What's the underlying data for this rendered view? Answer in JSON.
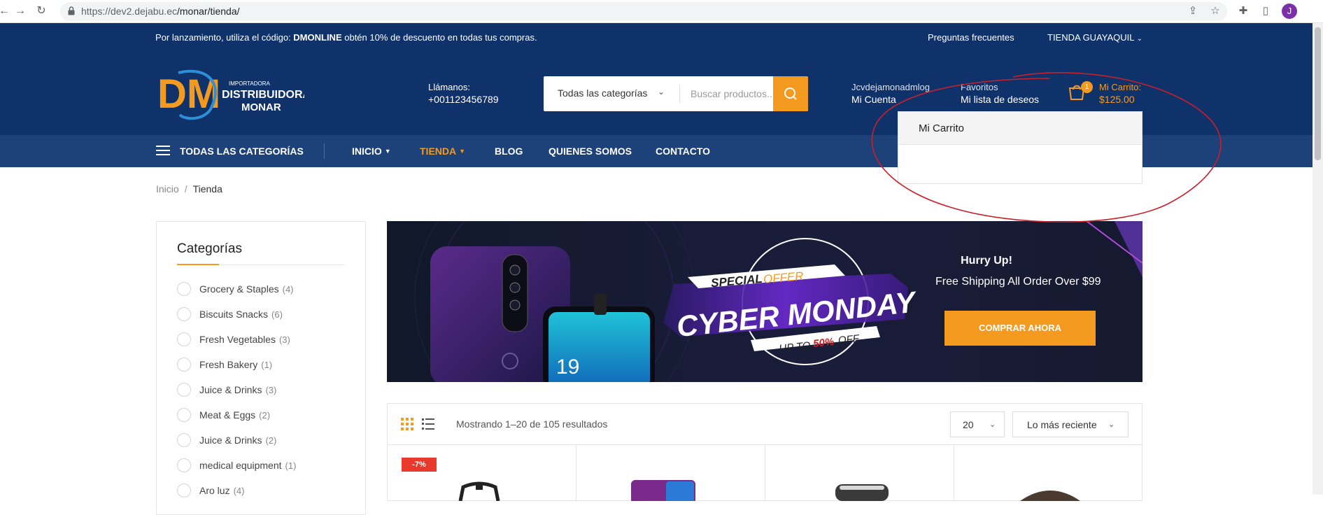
{
  "browser": {
    "url": "https://dev2.dejabu.ec/monar/tienda/",
    "url_host": "https://dev2.dejabu.ec",
    "url_path": "/monar/tienda/",
    "profile_initial": "J"
  },
  "topbar": {
    "promo_prefix": "Por lanzamiento, utiliza el código: ",
    "promo_code": "DMONLINE",
    "promo_suffix": " obtén 10% de descuento en todas tus compras.",
    "faq": "Preguntas frecuentes",
    "store": "TIENDA GUAYAQUIL"
  },
  "header": {
    "logo_top": "IMPORTADORA",
    "logo_mid": "DISTRIBUIDORA",
    "logo_bot": "MONAR",
    "logo_initials": "DM",
    "call_label": "Llámanos:",
    "call_number": "+001123456789",
    "search_category": "Todas las categorías",
    "search_placeholder": "Buscar productos...",
    "account_user": "Jcvdejamonadmlog",
    "account_link": "Mi Cuenta",
    "fav_label": "Favoritos",
    "fav_link": "Mi lista de deseos",
    "cart_count": "1",
    "cart_label": "Mi Carrito:",
    "cart_total": "$125.00"
  },
  "nav": {
    "all_categories": "TODAS LAS CATEGORÍAS",
    "items": [
      {
        "label": "INICIO",
        "has_caret": true,
        "active": false
      },
      {
        "label": "TIENDA",
        "has_caret": true,
        "active": true
      },
      {
        "label": "BLOG",
        "has_caret": false,
        "active": false
      },
      {
        "label": "QUIENES SOMOS",
        "has_caret": false,
        "active": false
      },
      {
        "label": "CONTACTO",
        "has_caret": false,
        "active": false
      }
    ]
  },
  "cart_dropdown": {
    "title": "Mi Carrito"
  },
  "breadcrumb": {
    "home": "Inicio",
    "separator": "/",
    "current": "Tienda"
  },
  "sidebar": {
    "title": "Categorías",
    "categories": [
      {
        "name": "Grocery & Staples",
        "count": "(4)"
      },
      {
        "name": "Biscuits Snacks",
        "count": "(6)"
      },
      {
        "name": "Fresh Vegetables",
        "count": "(3)"
      },
      {
        "name": "Fresh Bakery",
        "count": "(1)"
      },
      {
        "name": "Juice & Drinks",
        "count": "(3)"
      },
      {
        "name": "Meat & Eggs",
        "count": "(2)"
      },
      {
        "name": "Juice & Drinks",
        "count": "(2)"
      },
      {
        "name": "medical equipment",
        "count": "(1)"
      },
      {
        "name": "Aro luz",
        "count": "(4)"
      }
    ]
  },
  "banner": {
    "special": "SPECIAL",
    "offer": "OFFER",
    "headline": "CYBER MONDAY",
    "up_to": "UP TO",
    "percent": "50%",
    "off": "OFF",
    "phone_number": "19",
    "hurry": "Hurry Up!",
    "shipping": "Free Shipping All Order Over $99",
    "cta": "COMPRAR AHORA"
  },
  "toolbar": {
    "results": "Mostrando 1–20 de 105 resultados",
    "per_page": "20",
    "sort": "Lo más reciente"
  },
  "products": {
    "discount_badge": "-7%"
  },
  "colors": {
    "brand_navy": "#10326b",
    "nav_blue": "#1d4179",
    "accent_orange": "#f49a1f",
    "annotation_red": "#c8202a",
    "badge_red": "#e8392b"
  }
}
